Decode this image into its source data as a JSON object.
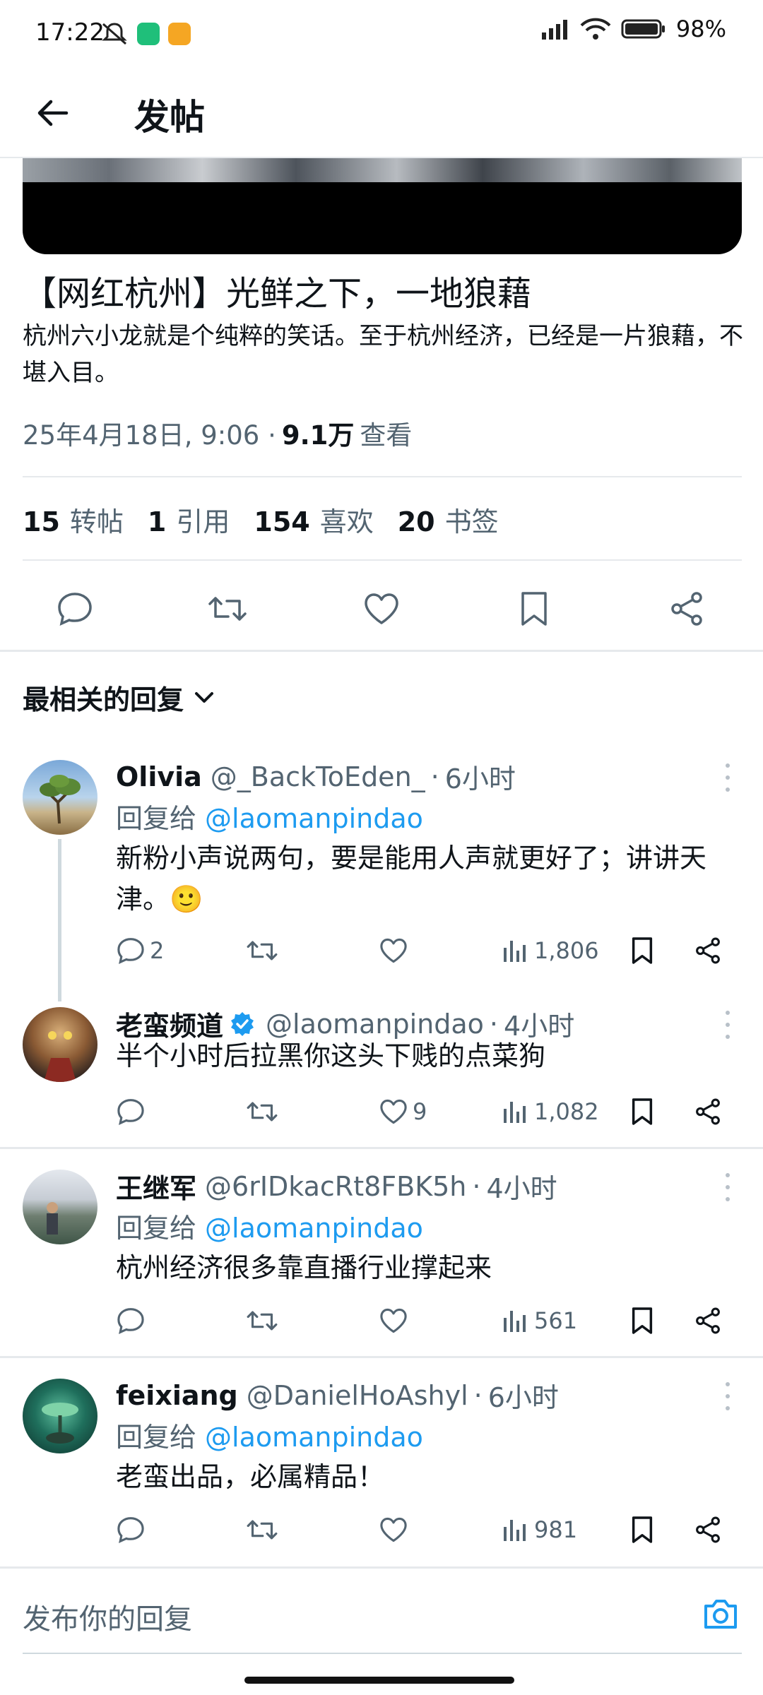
{
  "status_bar": {
    "time": "17:22",
    "battery": "98%"
  },
  "app_bar": {
    "title": "发帖"
  },
  "post": {
    "title": "【网红杭州】光鲜之下，一地狼藉",
    "body": "杭州六小龙就是个纯粹的笑话。至于杭州经济，已经是一片狼藉，不堪入目。",
    "date": "25年4月18日, 9:06 · ",
    "views_count": "9.1万",
    "views_label": " 查看",
    "stats": [
      {
        "count": "15",
        "label": "转帖"
      },
      {
        "count": "1",
        "label": "引用"
      },
      {
        "count": "154",
        "label": "喜欢"
      },
      {
        "count": "20",
        "label": "书签"
      }
    ]
  },
  "sort": {
    "label": "最相关的回复"
  },
  "replies": [
    {
      "name": "Olivia",
      "handle": "@_BackToEden_",
      "time": "6小时",
      "reply_to_label": "回复给",
      "reply_to": "@laomanpindao",
      "text": "新粉小声说两句，要是能用人声就更好了；讲讲天津。🙂",
      "replies": "2",
      "likes": "",
      "views": "1,806",
      "verified": false
    },
    {
      "name": "老蛮频道",
      "handle": "@laomanpindao",
      "time": "4小时",
      "reply_to_label": "",
      "reply_to": "",
      "text": "半个小时后拉黑你这头下贱的点菜狗",
      "replies": "",
      "likes": "9",
      "views": "1,082",
      "verified": true
    },
    {
      "name": "王继军",
      "handle": "@6rIDkacRt8FBK5h",
      "time": "4小时",
      "reply_to_label": "回复给",
      "reply_to": "@laomanpindao",
      "text": "杭州经济很多靠直播行业撑起来",
      "replies": "",
      "likes": "",
      "views": "561",
      "verified": false
    },
    {
      "name": "feixiang",
      "handle": "@DanielHoAshyl",
      "time": "6小时",
      "reply_to_label": "回复给",
      "reply_to": "@laomanpindao",
      "text": "老蛮出品，必属精品！",
      "replies": "",
      "likes": "",
      "views": "981",
      "verified": false
    }
  ],
  "compose": {
    "placeholder": "发布你的回复"
  },
  "colors": {
    "accent": "#1d9bf0",
    "muted": "#536471",
    "text": "#0f1419",
    "divider": "#e6e9ec"
  },
  "icons": [
    "back-arrow-icon",
    "reply-icon",
    "retweet-icon",
    "like-icon",
    "bookmark-icon",
    "share-icon",
    "views-icon",
    "verified-badge-icon",
    "camera-icon",
    "chevron-down-icon"
  ]
}
